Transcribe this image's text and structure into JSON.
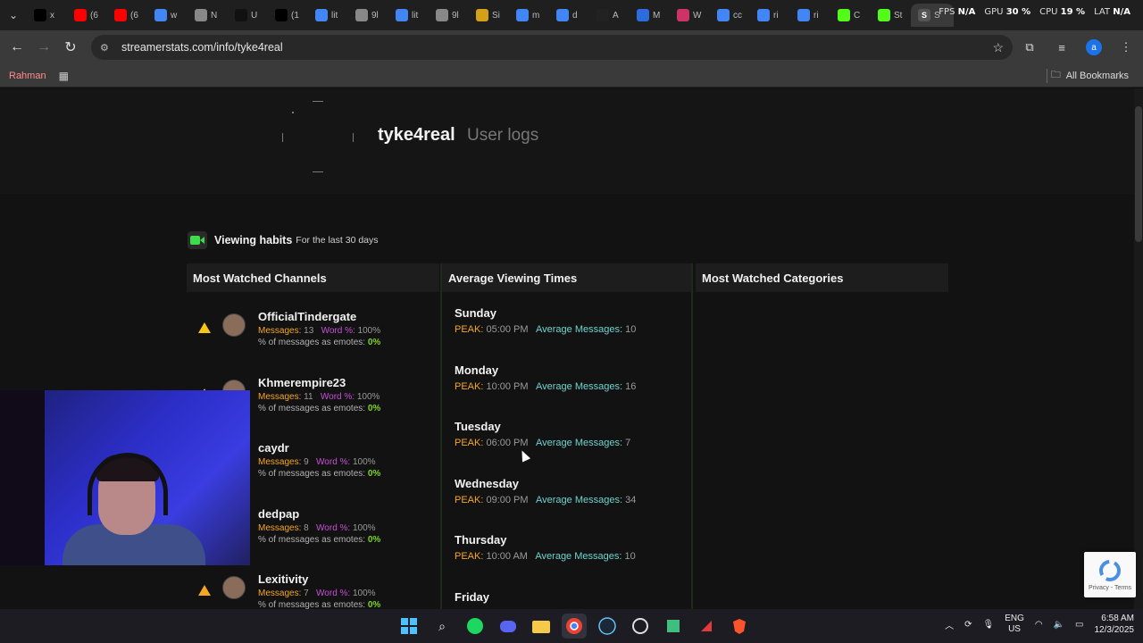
{
  "browser": {
    "tabs": [
      {
        "title": "x",
        "icon": "x-icon",
        "color": "#000000"
      },
      {
        "title": "(6",
        "icon": "youtube-icon",
        "color": "#ff0000"
      },
      {
        "title": "(6",
        "icon": "youtube-icon",
        "color": "#ff0000"
      },
      {
        "title": "w",
        "icon": "google-icon",
        "color": "#4285f4"
      },
      {
        "title": "N",
        "icon": "link-icon",
        "color": "#888888"
      },
      {
        "title": "U",
        "icon": "tiktok-icon",
        "color": "#111111"
      },
      {
        "title": "(1",
        "icon": "x-icon",
        "color": "#000000"
      },
      {
        "title": "lit",
        "icon": "google-icon",
        "color": "#4285f4"
      },
      {
        "title": "9l",
        "icon": "globe-icon",
        "color": "#888888"
      },
      {
        "title": "lit",
        "icon": "google-icon",
        "color": "#4285f4"
      },
      {
        "title": "9l",
        "icon": "globe-icon",
        "color": "#888888"
      },
      {
        "title": "Si",
        "icon": "bank-icon",
        "color": "#d4a017"
      },
      {
        "title": "m",
        "icon": "google-icon",
        "color": "#4285f4"
      },
      {
        "title": "d",
        "icon": "google-icon",
        "color": "#4285f4"
      },
      {
        "title": "A",
        "icon": "amazon-icon",
        "color": "#222222"
      },
      {
        "title": "M",
        "icon": "grid-icon",
        "color": "#2d6cdf"
      },
      {
        "title": "W",
        "icon": "w-icon",
        "color": "#cc3366"
      },
      {
        "title": "cc",
        "icon": "google-icon",
        "color": "#4285f4"
      },
      {
        "title": "ri",
        "icon": "google-icon",
        "color": "#4285f4"
      },
      {
        "title": "ri",
        "icon": "google-icon",
        "color": "#4285f4"
      },
      {
        "title": "C",
        "icon": "kick-icon",
        "color": "#53fc18"
      },
      {
        "title": "St",
        "icon": "kick-icon",
        "color": "#53fc18"
      }
    ],
    "active_tab": {
      "title": "S",
      "icon": "streamerstats-icon"
    },
    "overlay_stats": {
      "fps_label": "FPS",
      "fps_value": "N/A",
      "gpu_label": "GPU",
      "gpu_value": "30 %",
      "cpu_label": "CPU",
      "cpu_value": "19 %",
      "lat_label": "LAT",
      "lat_value": "N/A"
    },
    "url": "streamerstats.com/info/tyke4real",
    "profile_initial": "a",
    "bookmarks_profile": "Rahman",
    "all_bookmarks": "All Bookmarks"
  },
  "page": {
    "username": "tyke4real",
    "subtitle": "User logs",
    "section_title": "Viewing habits",
    "section_sub": "For the last 30 days",
    "columns": {
      "channels": "Most Watched Channels",
      "times": "Average Viewing Times",
      "categories": "Most Watched Categories"
    },
    "labels": {
      "messages": "Messages:",
      "word": "Word %:",
      "emotes": "% of messages as emotes:",
      "peak": "PEAK:",
      "avg": "Average Messages:"
    },
    "channels": [
      {
        "name": "OfficialTindergate",
        "messages": "13",
        "word": "100%",
        "emotes": "0%"
      },
      {
        "name": "Khmerempire23",
        "messages": "11",
        "word": "100%",
        "emotes": "0%"
      },
      {
        "name": "caydr",
        "messages": "9",
        "word": "100%",
        "emotes": "0%"
      },
      {
        "name": "dedpap",
        "messages": "8",
        "word": "100%",
        "emotes": "0%"
      },
      {
        "name": "Lexitivity",
        "messages": "7",
        "word": "100%",
        "emotes": "0%"
      }
    ],
    "days": [
      {
        "name": "Sunday",
        "peak": "05:00 PM",
        "avg": "10"
      },
      {
        "name": "Monday",
        "peak": "10:00 PM",
        "avg": "16"
      },
      {
        "name": "Tuesday",
        "peak": "06:00 PM",
        "avg": "7"
      },
      {
        "name": "Wednesday",
        "peak": "09:00 PM",
        "avg": "34"
      },
      {
        "name": "Thursday",
        "peak": "10:00 AM",
        "avg": "10"
      },
      {
        "name": "Friday",
        "peak": "",
        "avg": ""
      }
    ],
    "recaptcha_text": "Privacy - Terms"
  },
  "taskbar": {
    "lang_top": "ENG",
    "lang_bottom": "US",
    "time": "6:58 AM",
    "date": "12/3/2025"
  }
}
